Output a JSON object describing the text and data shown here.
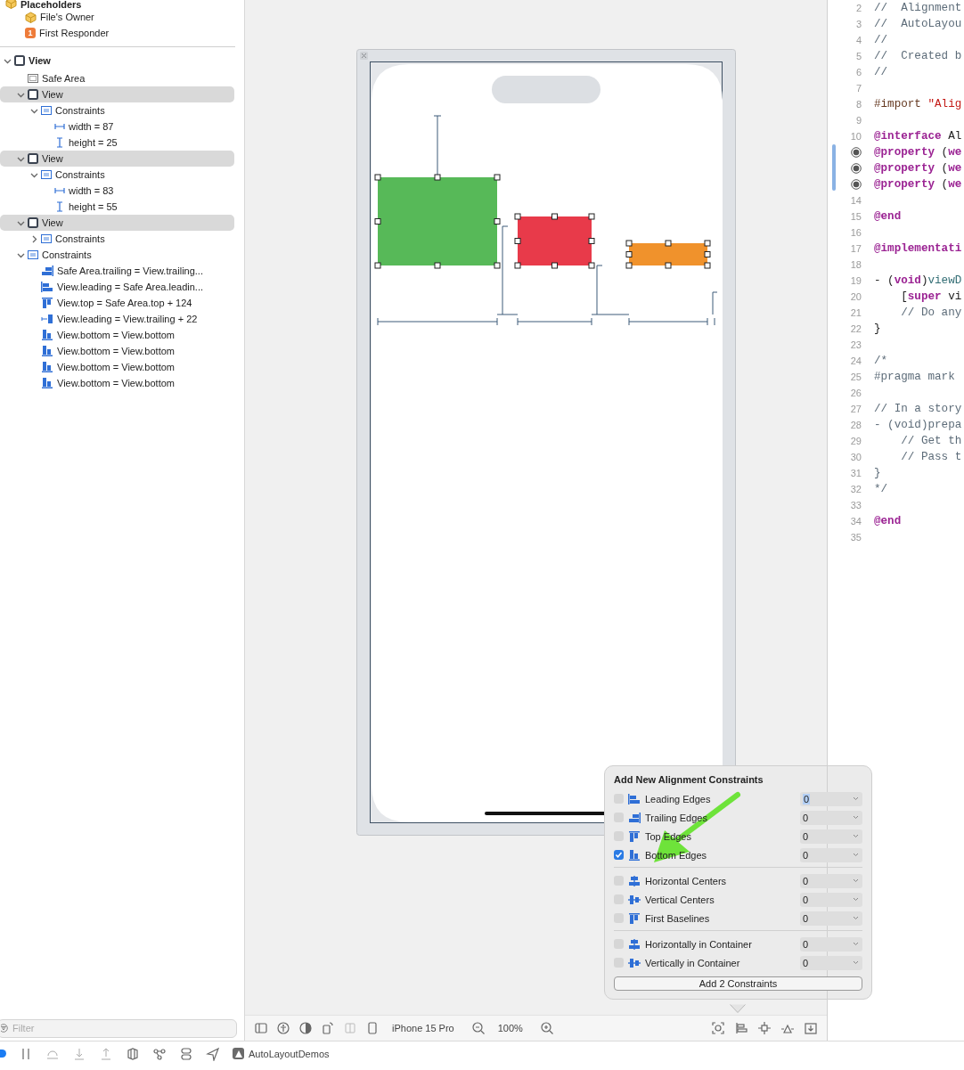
{
  "outline": {
    "placeholders": {
      "label": "Placeholders",
      "items": [
        {
          "kind": "owner",
          "label": "File's Owner"
        },
        {
          "kind": "responder",
          "label": "First Responder",
          "badge": "1"
        }
      ]
    },
    "tree": [
      {
        "kind": "view",
        "label": "View",
        "expanded": true,
        "selected": false,
        "children": [
          {
            "kind": "safe-area",
            "label": "Safe Area"
          },
          {
            "kind": "view",
            "label": "View",
            "expanded": true,
            "selected": true,
            "children": [
              {
                "kind": "constraints",
                "label": "Constraints",
                "expanded": true,
                "selected": false,
                "children": [
                  {
                    "kind": "width",
                    "label": "width = 87"
                  },
                  {
                    "kind": "height",
                    "label": "height = 25"
                  }
                ]
              }
            ]
          },
          {
            "kind": "view",
            "label": "View",
            "expanded": true,
            "selected": true,
            "children": [
              {
                "kind": "constraints",
                "label": "Constraints",
                "expanded": true,
                "selected": false,
                "children": [
                  {
                    "kind": "width",
                    "label": "width = 83"
                  },
                  {
                    "kind": "height",
                    "label": "height = 55"
                  }
                ]
              }
            ]
          },
          {
            "kind": "view",
            "label": "View",
            "expanded": true,
            "selected": true,
            "children": [
              {
                "kind": "constraints",
                "label": "Constraints",
                "expanded": false,
                "selected": false
              }
            ]
          },
          {
            "kind": "constraints",
            "label": "Constraints",
            "expanded": true,
            "selected": false,
            "children": [
              {
                "kind": "trailing",
                "label": "Safe Area.trailing = View.trailing..."
              },
              {
                "kind": "leading",
                "label": "View.leading = Safe Area.leadin..."
              },
              {
                "kind": "top",
                "label": "View.top = Safe Area.top + 124"
              },
              {
                "kind": "spacing",
                "label": "View.leading = View.trailing + 22"
              },
              {
                "kind": "bottom",
                "label": "View.bottom = View.bottom"
              },
              {
                "kind": "bottom",
                "label": "View.bottom = View.bottom"
              },
              {
                "kind": "bottom",
                "label": "View.bottom = View.bottom"
              },
              {
                "kind": "bottom",
                "label": "View.bottom = View.bottom"
              }
            ]
          }
        ]
      }
    ]
  },
  "filter": {
    "placeholder": "Filter"
  },
  "canvas": {
    "views": [
      {
        "color": "#57b958"
      },
      {
        "color": "#e83a4a"
      },
      {
        "color": "#f0922c"
      }
    ]
  },
  "canvas_toolbar": {
    "device": "iPhone 15 Pro",
    "zoom": "100%"
  },
  "popover": {
    "title": "Add New Alignment Constraints",
    "groups": [
      [
        {
          "kind": "leading",
          "label": "Leading Edges",
          "checked": false,
          "value": "0",
          "focused": true
        },
        {
          "kind": "trailing",
          "label": "Trailing Edges",
          "checked": false,
          "value": "0",
          "focused": false
        },
        {
          "kind": "top",
          "label": "Top Edges",
          "checked": false,
          "value": "0",
          "focused": false
        },
        {
          "kind": "bottom",
          "label": "Bottom Edges",
          "checked": true,
          "value": "0",
          "focused": false
        }
      ],
      [
        {
          "kind": "hcenter",
          "label": "Horizontal Centers",
          "checked": false,
          "value": "0",
          "focused": false
        },
        {
          "kind": "vcenter",
          "label": "Vertical Centers",
          "checked": false,
          "value": "0",
          "focused": false
        },
        {
          "kind": "top",
          "label": "First Baselines",
          "checked": false,
          "value": "0",
          "focused": false
        }
      ],
      [
        {
          "kind": "hcenter",
          "label": "Horizontally in Container",
          "checked": false,
          "value": "0",
          "focused": false
        },
        {
          "kind": "vcenter",
          "label": "Vertically in Container",
          "checked": false,
          "value": "0",
          "focused": false
        }
      ]
    ],
    "button": "Add 2 Constraints"
  },
  "editor": {
    "lines": [
      {
        "number": "2",
        "marker": false,
        "parts": [
          {
            "text": "//  Alignment",
            "kind": "comment"
          }
        ]
      },
      {
        "number": "3",
        "marker": false,
        "parts": [
          {
            "text": "//  AutoLayou",
            "kind": "comment"
          }
        ]
      },
      {
        "number": "4",
        "marker": false,
        "parts": [
          {
            "text": "//",
            "kind": "comment"
          }
        ]
      },
      {
        "number": "5",
        "marker": false,
        "parts": [
          {
            "text": "//  Created b",
            "kind": "comment"
          }
        ]
      },
      {
        "number": "6",
        "marker": false,
        "parts": [
          {
            "text": "//",
            "kind": "comment"
          }
        ]
      },
      {
        "number": "7",
        "marker": false
      },
      {
        "number": "8",
        "marker": false,
        "parts": [
          {
            "text": "#import",
            "kind": "directive"
          },
          {
            "text": " \"Alig",
            "kind": "string"
          }
        ]
      },
      {
        "number": "9",
        "marker": false
      },
      {
        "number": "10",
        "marker": false,
        "parts": [
          {
            "text": "@interface",
            "kind": "keyword"
          },
          {
            "text": " Al",
            "kind": "plain"
          }
        ]
      },
      {
        "marker": true,
        "parts": [
          {
            "text": "@property",
            "kind": "keyword"
          },
          {
            "text": " (",
            "kind": "plain"
          },
          {
            "text": "we",
            "kind": "keyword"
          }
        ]
      },
      {
        "marker": true,
        "parts": [
          {
            "text": "@property",
            "kind": "keyword"
          },
          {
            "text": " (",
            "kind": "plain"
          },
          {
            "text": "we",
            "kind": "keyword"
          }
        ]
      },
      {
        "marker": true,
        "parts": [
          {
            "text": "@property",
            "kind": "keyword"
          },
          {
            "text": " (",
            "kind": "plain"
          },
          {
            "text": "we",
            "kind": "keyword"
          }
        ]
      },
      {
        "number": "14",
        "marker": false
      },
      {
        "number": "15",
        "marker": false,
        "parts": [
          {
            "text": "@end",
            "kind": "keyword"
          }
        ]
      },
      {
        "number": "16",
        "marker": false
      },
      {
        "number": "17",
        "marker": false,
        "parts": [
          {
            "text": "@implementati",
            "kind": "keyword"
          }
        ]
      },
      {
        "number": "18",
        "marker": false
      },
      {
        "number": "19",
        "marker": false,
        "parts": [
          {
            "text": "- (",
            "kind": "plain"
          },
          {
            "text": "void",
            "kind": "keyword"
          },
          {
            "text": ")",
            "kind": "plain"
          },
          {
            "text": "viewD",
            "kind": "method"
          }
        ]
      },
      {
        "number": "20",
        "marker": false,
        "parts": [
          {
            "text": "    [",
            "kind": "plain"
          },
          {
            "text": "super",
            "kind": "keyword"
          },
          {
            "text": " vi",
            "kind": "plain"
          }
        ]
      },
      {
        "number": "21",
        "marker": false,
        "parts": [
          {
            "text": "    // Do any",
            "kind": "comment"
          }
        ]
      },
      {
        "number": "22",
        "marker": false,
        "parts": [
          {
            "text": "}",
            "kind": "plain"
          }
        ]
      },
      {
        "number": "23",
        "marker": false
      },
      {
        "number": "24",
        "marker": false,
        "parts": [
          {
            "text": "/*",
            "kind": "comment"
          }
        ]
      },
      {
        "number": "25",
        "marker": false,
        "parts": [
          {
            "text": "#pragma mark",
            "kind": "comment"
          }
        ]
      },
      {
        "number": "26",
        "marker": false
      },
      {
        "number": "27",
        "marker": false,
        "parts": [
          {
            "text": "// In a story",
            "kind": "comment"
          }
        ]
      },
      {
        "number": "28",
        "marker": false,
        "parts": [
          {
            "text": "- (void)prepa",
            "kind": "comment"
          }
        ]
      },
      {
        "number": "29",
        "marker": false,
        "parts": [
          {
            "text": "    // Get th",
            "kind": "comment"
          }
        ]
      },
      {
        "number": "30",
        "marker": false,
        "parts": [
          {
            "text": "    // Pass t",
            "kind": "comment"
          }
        ]
      },
      {
        "number": "31",
        "marker": false,
        "parts": [
          {
            "text": "}",
            "kind": "comment"
          }
        ]
      },
      {
        "number": "32",
        "marker": false,
        "parts": [
          {
            "text": "*/",
            "kind": "comment"
          }
        ]
      },
      {
        "number": "33",
        "marker": false
      },
      {
        "number": "34",
        "marker": false,
        "parts": [
          {
            "text": "@end",
            "kind": "keyword"
          }
        ]
      },
      {
        "number": "35",
        "marker": false
      }
    ]
  },
  "bottom_toolbar": {
    "scheme": "AutoLayoutDemos"
  }
}
